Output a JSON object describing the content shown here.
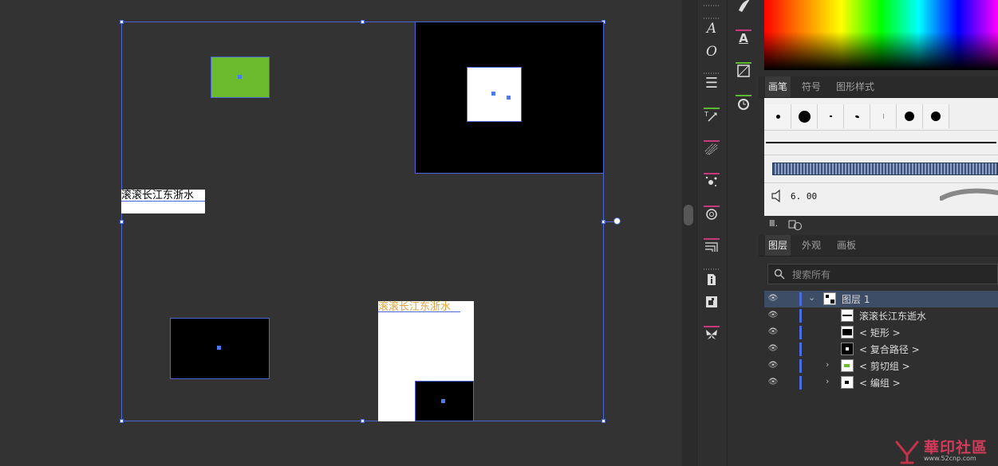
{
  "canvas": {
    "text1": "滚滚长江东浙水",
    "text2": "滚滚长江东浙水"
  },
  "tools": {
    "type_a": "A",
    "type_o": "O"
  },
  "brush_panel": {
    "tabs": [
      "画笔",
      "符号",
      "图形样式"
    ],
    "stroke_value": "6. 00"
  },
  "layers_panel": {
    "tabs": [
      "图层",
      "外观",
      "画板"
    ],
    "search_placeholder": "搜索所有",
    "rows": [
      {
        "name": "图层  1",
        "expanded": true
      },
      {
        "name": "滚滚长江东逝水"
      },
      {
        "name": "< 矩形 >"
      },
      {
        "name": "< 复合路径 >"
      },
      {
        "name": "< 剪切组 >",
        "collapsed": true
      },
      {
        "name": "< 编组 >",
        "collapsed": true
      }
    ]
  },
  "watermark": {
    "title": "華印社區",
    "url": "www.52cnp.com"
  },
  "colors": {
    "selection": "#4b66d6",
    "green_rect": "#6cba2e",
    "text_orange": "#e2a23a",
    "layer_highlight": "#3d4d66"
  }
}
